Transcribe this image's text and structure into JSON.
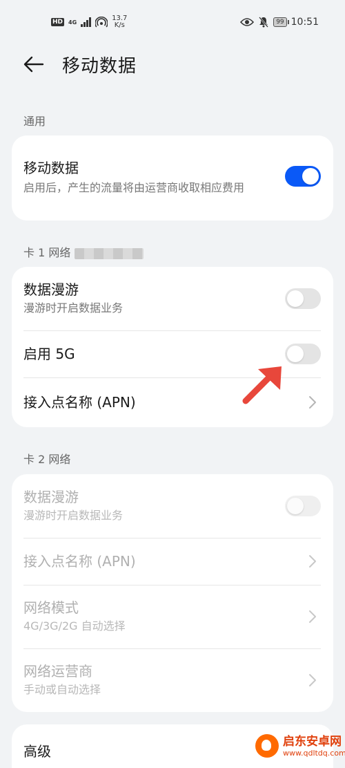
{
  "status_bar": {
    "hd": "HD",
    "net_type": "4G",
    "speed_value": "13.7",
    "speed_unit": "K/s",
    "battery": "99",
    "time": "10:51"
  },
  "header": {
    "title": "移动数据"
  },
  "sections": {
    "general_label": "通用",
    "card1_label": "卡 1 网络",
    "card2_label": "卡 2 网络"
  },
  "general": {
    "mobile_data_title": "移动数据",
    "mobile_data_desc": "启用后，产生的流量将由运营商收取相应费用",
    "mobile_data_on": true
  },
  "card1": {
    "roaming_title": "数据漫游",
    "roaming_desc": "漫游时开启数据业务",
    "enable5g_title": "启用 5G",
    "apn_title": "接入点名称 (APN)"
  },
  "card2": {
    "roaming_title": "数据漫游",
    "roaming_desc": "漫游时开启数据业务",
    "apn_title": "接入点名称 (APN)",
    "network_mode_title": "网络模式",
    "network_mode_desc": "4G/3G/2G 自动选择",
    "operator_title": "网络运营商",
    "operator_desc": "手动或自动选择"
  },
  "advanced": {
    "title": "高级"
  },
  "watermark": {
    "title": "启东安卓网",
    "url": "www.qdltdq.com"
  },
  "colors": {
    "accent": "#0a59f7",
    "annotation_arrow": "#e8473b"
  }
}
